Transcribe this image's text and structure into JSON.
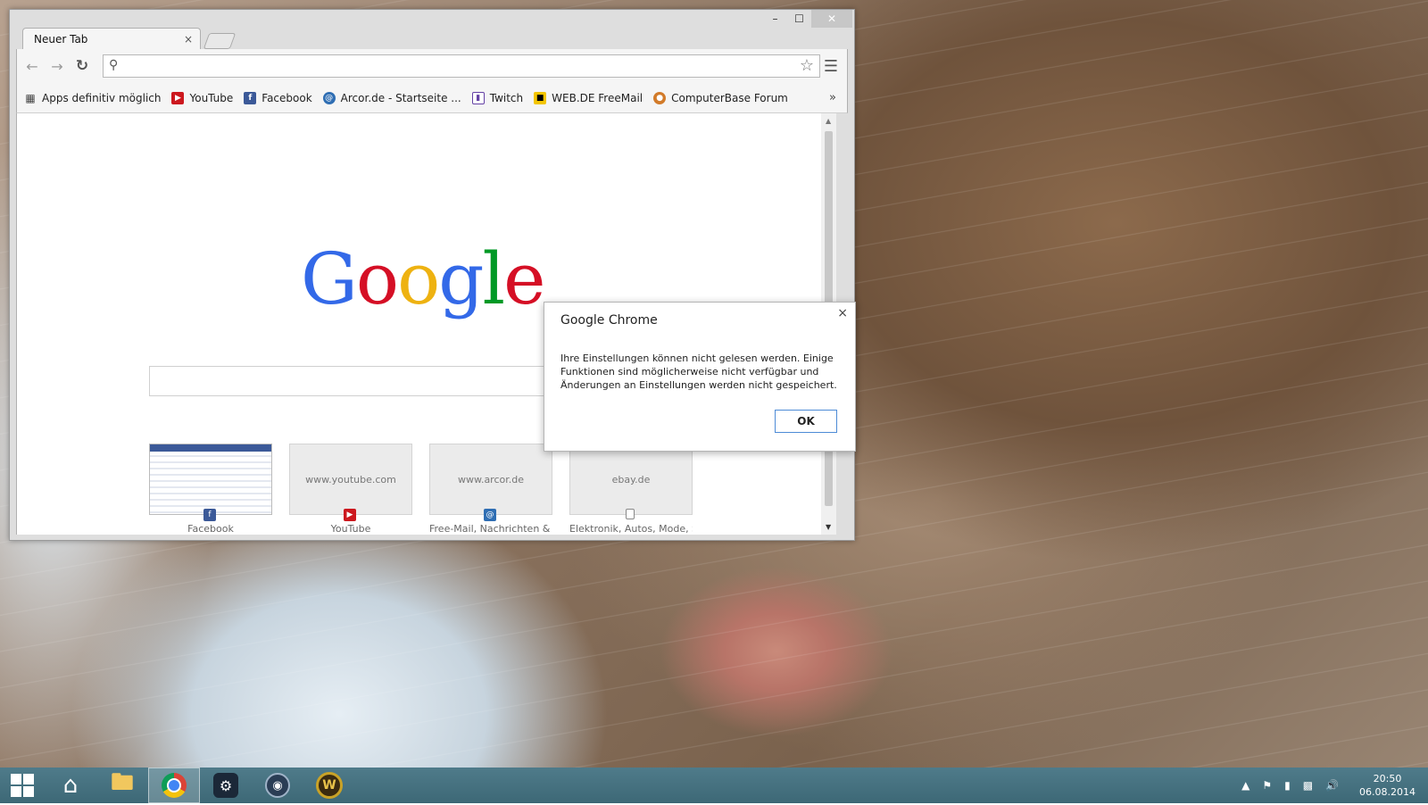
{
  "browser": {
    "tab_title": "Neuer Tab",
    "tab_close": "×",
    "window_controls": {
      "minimize": "–",
      "maximize": "☐",
      "close": "✕"
    },
    "omnibox": {
      "value": "",
      "placeholder": ""
    },
    "bookmarks": [
      {
        "label": "Apps definitiv möglich",
        "icon": "apps-grid-icon"
      },
      {
        "label": "YouTube",
        "icon": "youtube-icon"
      },
      {
        "label": "Facebook",
        "icon": "facebook-icon"
      },
      {
        "label": "Arcor.de - Startseite ...",
        "icon": "arcor-icon"
      },
      {
        "label": "Twitch",
        "icon": "twitch-icon"
      },
      {
        "label": "WEB.DE FreeMail",
        "icon": "webde-icon"
      },
      {
        "label": "ComputerBase Forum",
        "icon": "computerbase-icon"
      }
    ],
    "bookmarks_more": "»"
  },
  "page": {
    "logo_letters": [
      "G",
      "o",
      "o",
      "g",
      "l",
      "e"
    ],
    "logo_colors": [
      "#3369e8",
      "#d50f25",
      "#eeb211",
      "#3369e8",
      "#009925",
      "#d50f25"
    ],
    "tiles": [
      {
        "thumb_text": "",
        "label": "Facebook",
        "favicon": "f",
        "favicon_color": "#3b5998"
      },
      {
        "thumb_text": "www.youtube.com",
        "label": "YouTube",
        "favicon": "▶",
        "favicon_color": "#cc181e"
      },
      {
        "thumb_text": "www.arcor.de",
        "label": "Free-Mail, Nachrichten & U...",
        "favicon": "@",
        "favicon_color": "#2f6eb3"
      },
      {
        "thumb_text": "ebay.de",
        "label": "Elektronik, Autos, Mode, S...",
        "favicon": "",
        "favicon_color": "#ffffff"
      }
    ]
  },
  "dialog": {
    "title": "Google Chrome",
    "close": "×",
    "message": "Ihre Einstellungen können nicht gelesen werden. Einige Funktionen sind möglicherweise nicht verfügbar und Änderungen an Einstellungen werden nicht gespeichert.",
    "ok_label": "OK"
  },
  "taskbar": {
    "clock_time": "20:50",
    "clock_date": "06.08.2014"
  }
}
